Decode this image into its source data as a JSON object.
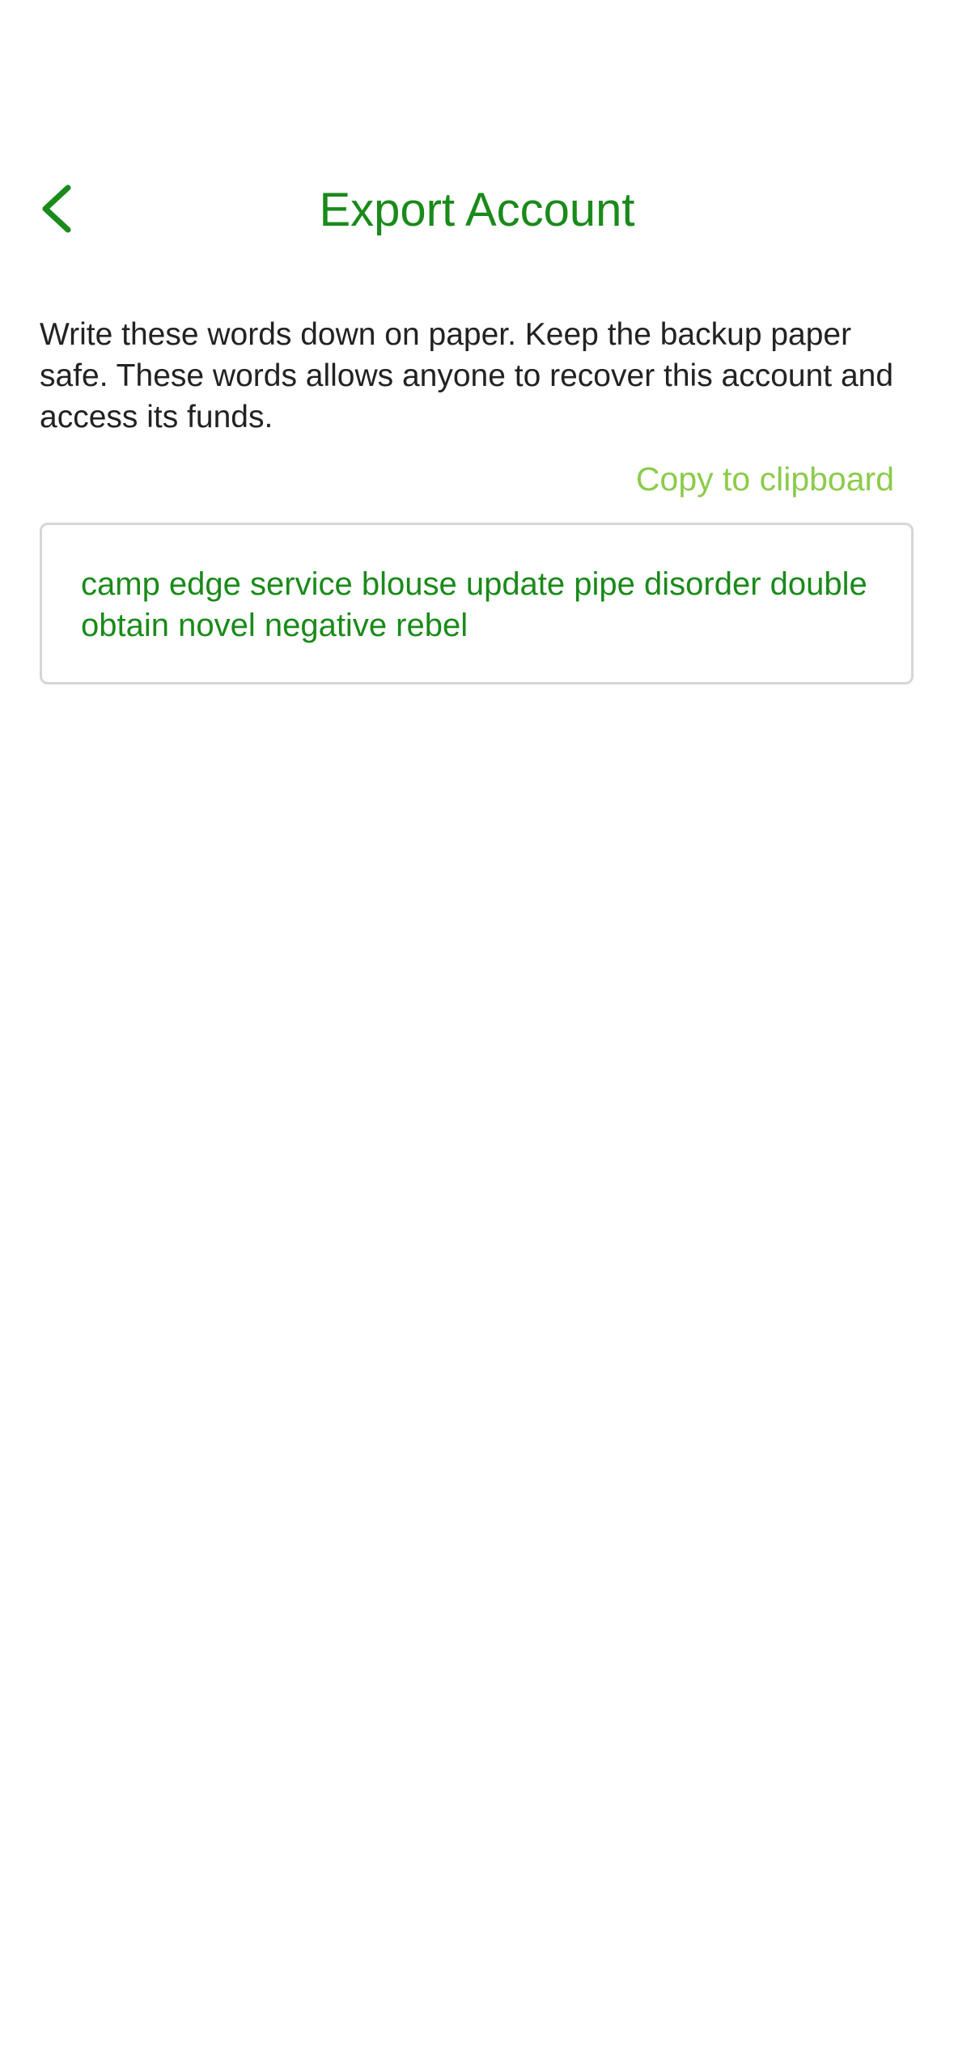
{
  "header": {
    "title": "Export Account",
    "back_icon": "chevron-left-icon"
  },
  "main": {
    "instructions": "Write these words down on paper. Keep the backup paper safe. These words allows anyone to recover this account and access its funds.",
    "copy_label": "Copy to clipboard",
    "recovery_phrase": "camp edge service blouse update pipe disorder double obtain novel negative rebel"
  },
  "colors": {
    "accent": "#1a8a1a",
    "link": "#8ccb4a",
    "text": "#222222",
    "border": "#d6d6d6"
  }
}
